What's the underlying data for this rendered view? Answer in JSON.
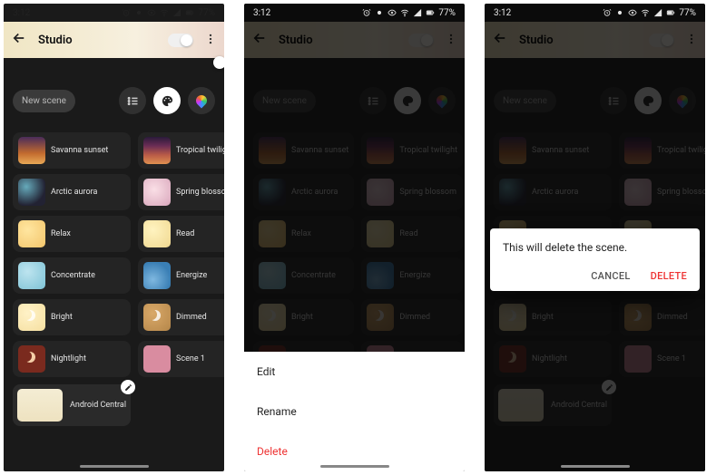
{
  "status": {
    "time": "3:12",
    "battery": "77%"
  },
  "header": {
    "title": "Studio"
  },
  "toolbar": {
    "new_scene": "New scene"
  },
  "scenes": [
    {
      "label": "Savanna sunset",
      "theme": "th-savanna"
    },
    {
      "label": "Tropical twilight",
      "theme": "th-tropical"
    },
    {
      "label": "Arctic aurora",
      "theme": "th-aurora"
    },
    {
      "label": "Spring blossom",
      "theme": "th-blossom"
    },
    {
      "label": "Relax",
      "theme": "th-relax"
    },
    {
      "label": "Read",
      "theme": "th-read"
    },
    {
      "label": "Concentrate",
      "theme": "th-concentrate"
    },
    {
      "label": "Energize",
      "theme": "th-energize"
    },
    {
      "label": "Bright",
      "theme": "th-bright moon"
    },
    {
      "label": "Dimmed",
      "theme": "th-dimmed moon"
    },
    {
      "label": "Nightlight",
      "theme": "th-nightlight"
    },
    {
      "label": "Scene 1",
      "theme": "th-scene1"
    }
  ],
  "custom_scene": {
    "label": "Android Central",
    "theme": "th-ac"
  },
  "sheet": {
    "edit": "Edit",
    "rename": "Rename",
    "delete": "Delete"
  },
  "dialog": {
    "message": "This will delete the scene.",
    "cancel": "CANCEL",
    "delete": "DELETE"
  }
}
